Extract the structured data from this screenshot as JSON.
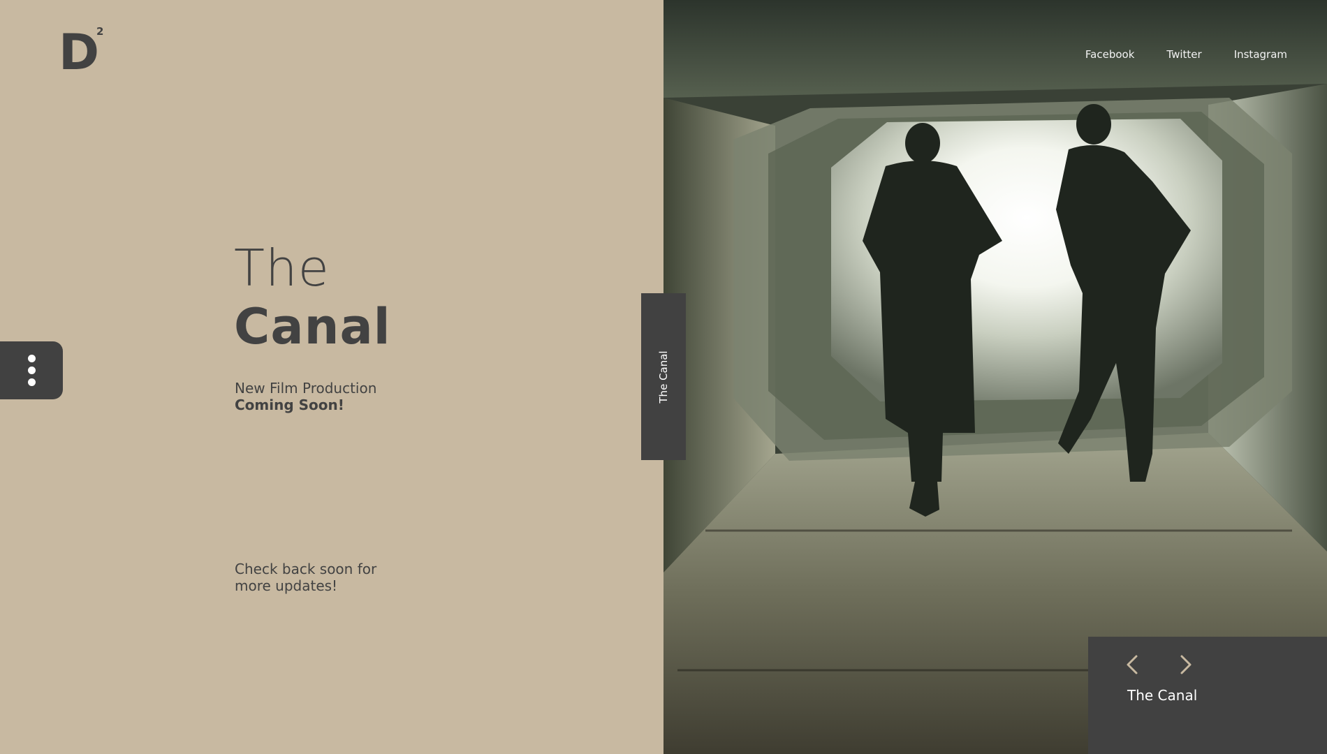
{
  "brand": {
    "logo_letter": "D",
    "logo_superscript": "2"
  },
  "hero": {
    "title_line1": "The",
    "title_line2": "Canal",
    "subtitle": "New Film Production",
    "subtitle_emphasis": "Coming Soon!",
    "updates_line1": "Check back soon for",
    "updates_line2": "more updates!"
  },
  "social": {
    "facebook": "Facebook",
    "twitter": "Twitter",
    "instagram": "Instagram"
  },
  "side_tab": {
    "label": "The Canal"
  },
  "slider": {
    "caption": "The Canal"
  },
  "colors": {
    "background": "#c8b9a1",
    "panel_dark": "#414141",
    "text_dark": "#424242",
    "arrow_accent": "#c8b9a1"
  },
  "icons": {
    "menu": "vertical-dots-icon",
    "prev": "chevron-left-icon",
    "next": "chevron-right-icon"
  }
}
